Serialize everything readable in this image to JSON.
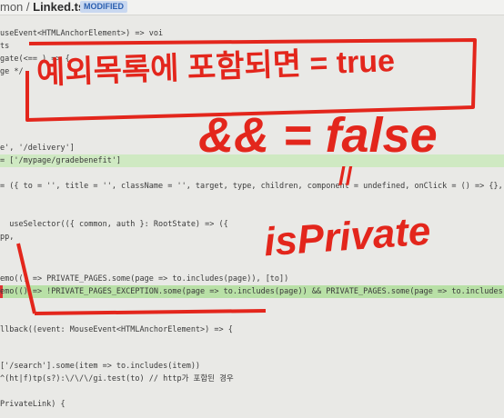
{
  "header": {
    "path_prefix": "mon / ",
    "file_name": "Linked.tsx",
    "badge": "MODIFIED"
  },
  "code_lines": [
    {
      "text": ""
    },
    {
      "text": "useEvent<HTMLAnchorElement>) => voi"
    },
    {
      "text": "ts"
    },
    {
      "text": "gate(<== ) => {"
    },
    {
      "text": "ge */"
    },
    {
      "text": ""
    },
    {
      "text": ""
    },
    {
      "text": ""
    },
    {
      "text": ""
    },
    {
      "text": ""
    },
    {
      "text": "e', '/delivery']"
    },
    {
      "text": "= ['/mypage/gradebenefit']"
    },
    {
      "text": ""
    },
    {
      "text": "= ({ to = '', title = '', className = '', target, type, children, component = undefined, onClick = () => {}, unusedAppScheme"
    },
    {
      "text": ""
    },
    {
      "text": ""
    },
    {
      "text": "  useSelector(({ common, auth }: RootState) => ({"
    },
    {
      "text": "pp,"
    },
    {
      "text": ""
    },
    {
      "text": ""
    },
    {
      "text": ""
    },
    {
      "text": "emo(() => PRIVATE_PAGES.some(page => to.includes(page)), [to])"
    },
    {
      "text": "emo(() => !PRIVATE_PAGES_EXCEPTION.some(page => to.includes(page)) && PRIVATE_PAGES.some(page => to.includes(page)), [to])"
    },
    {
      "text": ""
    },
    {
      "text": ""
    },
    {
      "text": ""
    },
    {
      "text": "llback((event: MouseEvent<HTMLAnchorElement>) => {"
    },
    {
      "text": ""
    },
    {
      "text": ""
    },
    {
      "text": "['/search'].some(item => to.includes(item))"
    },
    {
      "text": "^(ht|f)tp(s?):\\/\\/\\/gi.test(to) // http가 포함된 경우"
    },
    {
      "text": ""
    },
    {
      "text": "PrivateLink) {"
    }
  ],
  "annotations": {
    "boxed_note": "예외목록에 포함되면 = true",
    "and_false": "&& = false",
    "slash": "//",
    "is_private": "isPrivate"
  }
}
